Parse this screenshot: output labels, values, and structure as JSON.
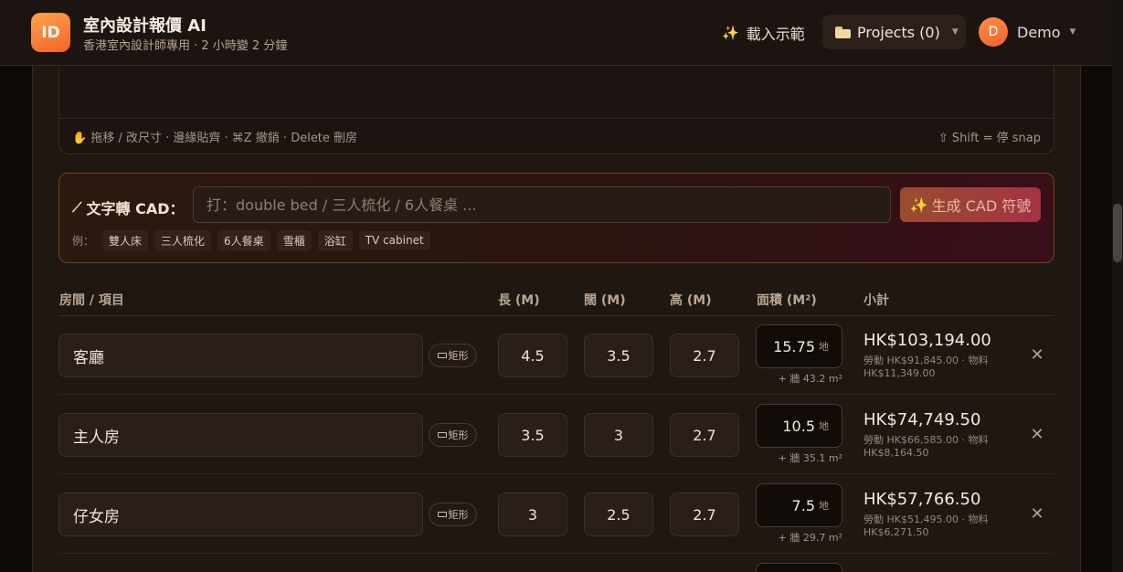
{
  "header": {
    "logo_text": "ID",
    "title": "室內設計報價 AI",
    "subtitle": "香港室內設計師專用 · 2 小時變 2 分鐘",
    "demo_label": "載入示範",
    "projects_label": "Projects (0)",
    "user_initial": "D",
    "user_name": "Demo"
  },
  "canvas": {
    "hint_left": "✋ 拖移 / 改尺寸 · 邊緣貼齊 · ⌘Z 撤銷 · Delete 刪房",
    "hint_right": "⇧ Shift = 停 snap"
  },
  "cad": {
    "label": "文字轉 CAD：",
    "placeholder": "打：double bed / 三人梳化 / 6人餐桌 ...",
    "generate_label": "生成 CAD 符號",
    "examples_label": "例：",
    "examples": [
      "雙人床",
      "三人梳化",
      "6人餐桌",
      "雪櫃",
      "浴缸",
      "TV cabinet"
    ]
  },
  "table": {
    "headers": {
      "room": "房間 / 項目",
      "length": "長 (M)",
      "width": "闊 (M)",
      "height": "高 (M)",
      "area": "面積 (M²)",
      "subtotal": "小計"
    },
    "shape_label": "矩形",
    "area_unit": "地",
    "rows": [
      {
        "room": "客廳",
        "length": "4.5",
        "width": "3.5",
        "height": "2.7",
        "area": "15.75",
        "wall": "+ 牆 43.2 m²",
        "subtotal": "HK$103,194.00",
        "breakdown": "勞動 HK$91,845.00 · 物料 HK$11,349.00"
      },
      {
        "room": "主人房",
        "length": "3.5",
        "width": "3",
        "height": "2.7",
        "area": "10.5",
        "wall": "+ 牆 35.1 m²",
        "subtotal": "HK$74,749.50",
        "breakdown": "勞動 HK$66,585.00 · 物料 HK$8,164.50"
      },
      {
        "room": "仔女房",
        "length": "3",
        "width": "2.5",
        "height": "2.7",
        "area": "7.5",
        "wall": "+ 牆 29.7 m²",
        "subtotal": "HK$57,766.50",
        "breakdown": "勞動 HK$51,495.00 · 物料 HK$6,271.50"
      }
    ]
  }
}
